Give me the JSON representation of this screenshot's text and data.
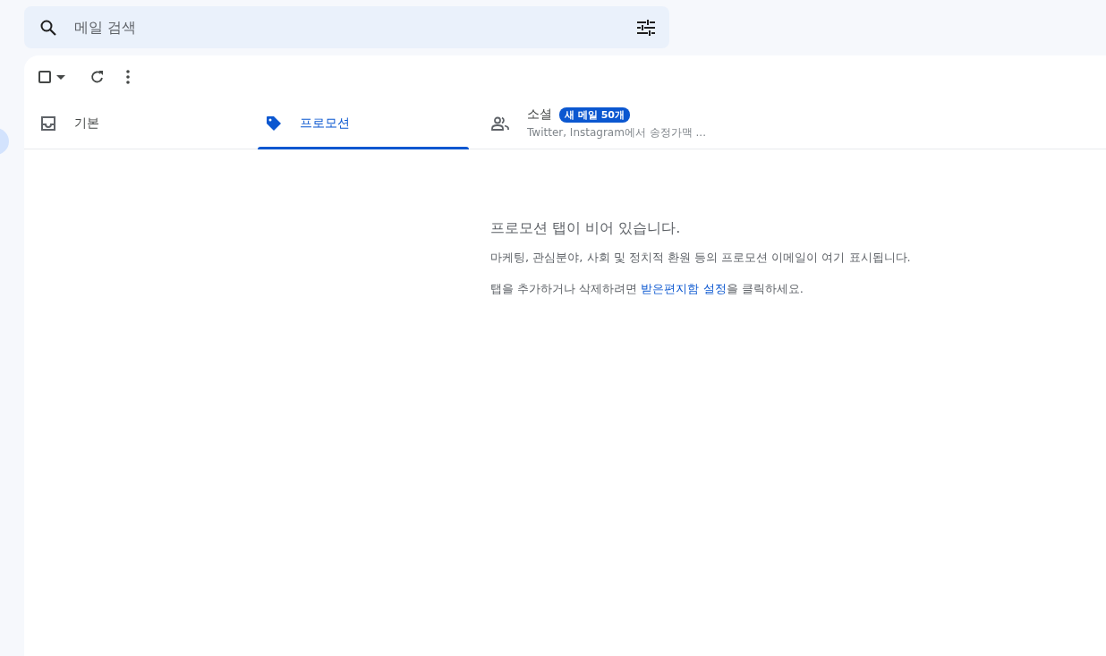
{
  "search": {
    "placeholder": "메일 검색"
  },
  "toolbar": {
    "select_all": {
      "checked": false
    }
  },
  "tabs": [
    {
      "kind": "inbox",
      "label": "기본",
      "selected": false
    },
    {
      "kind": "tag",
      "label": "프로모션",
      "selected": true
    },
    {
      "kind": "people",
      "label": "소셜",
      "selected": false,
      "badge": "새 메일 50개",
      "subtitle": "Twitter, Instagram에서 송정가맥 ..."
    }
  ],
  "empty_state": {
    "title": "프로모션 탭이 비어 있습니다.",
    "description": "마케팅, 관심분야, 사회 및 정치적 환원 등의 프로모션 이메일이 여기 표시됩니다.",
    "hint": {
      "before": "탭을 추가하거나 삭제하려면 ",
      "link": "받은편지함 설정",
      "after": "을 클릭하세요."
    }
  }
}
